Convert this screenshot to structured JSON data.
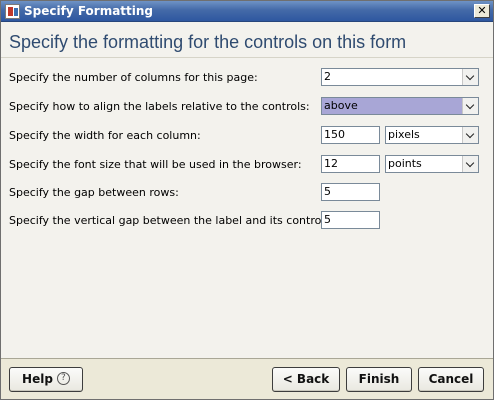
{
  "window": {
    "title": "Specify Formatting",
    "close_glyph": "✕"
  },
  "heading": "Specify the formatting for the controls on this form",
  "rows": [
    {
      "label": "Specify the number of columns for this page:",
      "value": "2"
    },
    {
      "label": "Specify how to align the labels relative to the controls:",
      "value": "above"
    },
    {
      "label": "Specify the width for each column:",
      "value": "150",
      "unit": "pixels"
    },
    {
      "label": "Specify the font size that will be used in the browser:",
      "value": "12",
      "unit": "points"
    },
    {
      "label": "Specify the gap between rows:",
      "value": "5"
    },
    {
      "label": "Specify the vertical gap between the label and its control:",
      "value": "5"
    }
  ],
  "buttons": {
    "help": "Help",
    "help_glyph": "?",
    "back": "< Back",
    "finish": "Finish",
    "cancel": "Cancel"
  },
  "colors": {
    "title_bar": "#446aa8",
    "heading": "#2f4b70",
    "selected_combo": "#a8a6d6"
  },
  "icons": [
    "app-icon",
    "close-icon",
    "chevron-down-icon",
    "help-icon"
  ]
}
